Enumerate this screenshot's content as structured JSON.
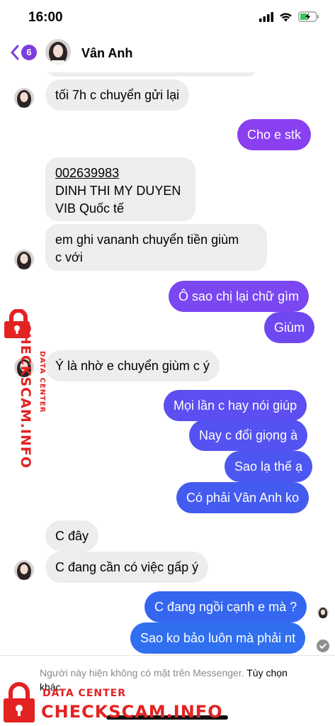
{
  "status_bar": {
    "time": "16:00"
  },
  "header": {
    "back_count": "6",
    "contact_name": "Vân Anh"
  },
  "messages": [
    {
      "side": "in",
      "text": "tối 7h c chuyển gửi lại"
    },
    {
      "side": "out",
      "text": "Cho e stk"
    },
    {
      "side": "in",
      "lines": [
        "002639983",
        "DINH THI MY DUYEN",
        "VIB Quốc tế"
      ]
    },
    {
      "side": "in",
      "lines": [
        "em ghi vananh chuyển tiền giùm",
        "c với"
      ]
    },
    {
      "side": "out",
      "text": "Ô sao chị lại chữ gìm"
    },
    {
      "side": "out",
      "text": "Giùm"
    },
    {
      "side": "in",
      "text": "Ý là nhờ e chuyển giùm c ý"
    },
    {
      "side": "out",
      "text": "Mọi lần c hay nói giúp"
    },
    {
      "side": "out",
      "text": "Nay c đổi giọng à"
    },
    {
      "side": "out",
      "text": "Sao lạ thế ạ"
    },
    {
      "side": "out",
      "text": "Có phải Vân Anh ko"
    },
    {
      "side": "in",
      "text": "C đây"
    },
    {
      "side": "in",
      "text": "C đang cần có việc gấp ý"
    },
    {
      "side": "out",
      "text": "C đang ngồi cạnh e mà ?"
    },
    {
      "side": "out",
      "text": "Sao ko bảo luôn mà phải nt"
    }
  ],
  "footer": {
    "notice": "Người này hiện không có mặt trên Messenger.",
    "options_link": "Tùy chọn khác"
  },
  "watermark": {
    "line1": "DATA CENTER",
    "line2": "CHECKSCAM.INFO"
  },
  "colors": {
    "purple": "#8a3ff0",
    "violet": "#6a4cf0",
    "blue": "#2f6ff0",
    "incoming": "#ededed",
    "watermark": "#e32222"
  }
}
